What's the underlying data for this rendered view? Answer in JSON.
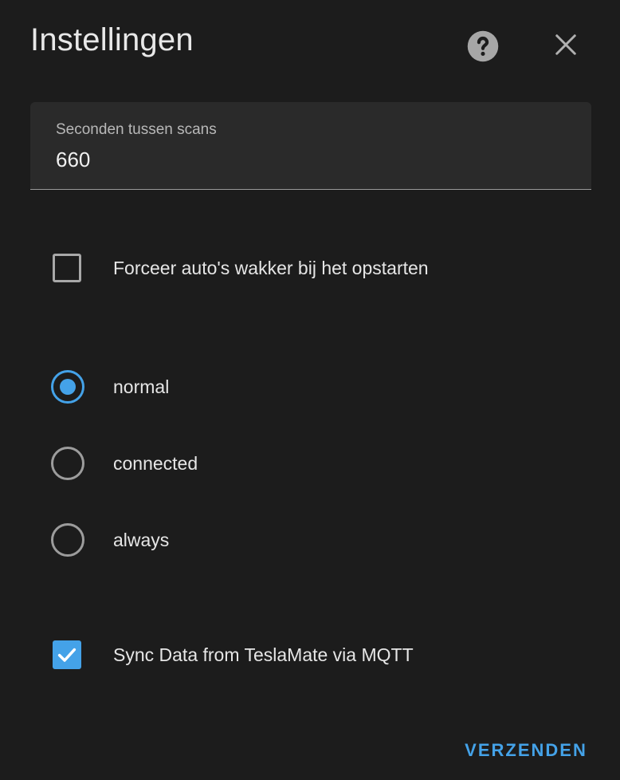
{
  "dialog": {
    "title": "Instellingen",
    "help_icon": "help-circle-icon",
    "close_icon": "close-icon"
  },
  "scan_interval": {
    "label": "Seconden tussen scans",
    "value": "660"
  },
  "force_wake": {
    "label": "Forceer auto's wakker bij het opstarten",
    "checked": false
  },
  "polling_policy": {
    "selected": "normal",
    "options": [
      {
        "label": "normal",
        "selected": true
      },
      {
        "label": "connected",
        "selected": false
      },
      {
        "label": "always",
        "selected": false
      }
    ]
  },
  "teslamate_sync": {
    "label": "Sync Data from TeslaMate via MQTT",
    "checked": true
  },
  "actions": {
    "submit_label": "VERZENDEN"
  },
  "colors": {
    "background": "#1c1c1c",
    "field_background": "#2a2a2a",
    "accent": "#44a2e8",
    "text": "#e6e6e6",
    "muted_text": "#b8b8b8"
  }
}
